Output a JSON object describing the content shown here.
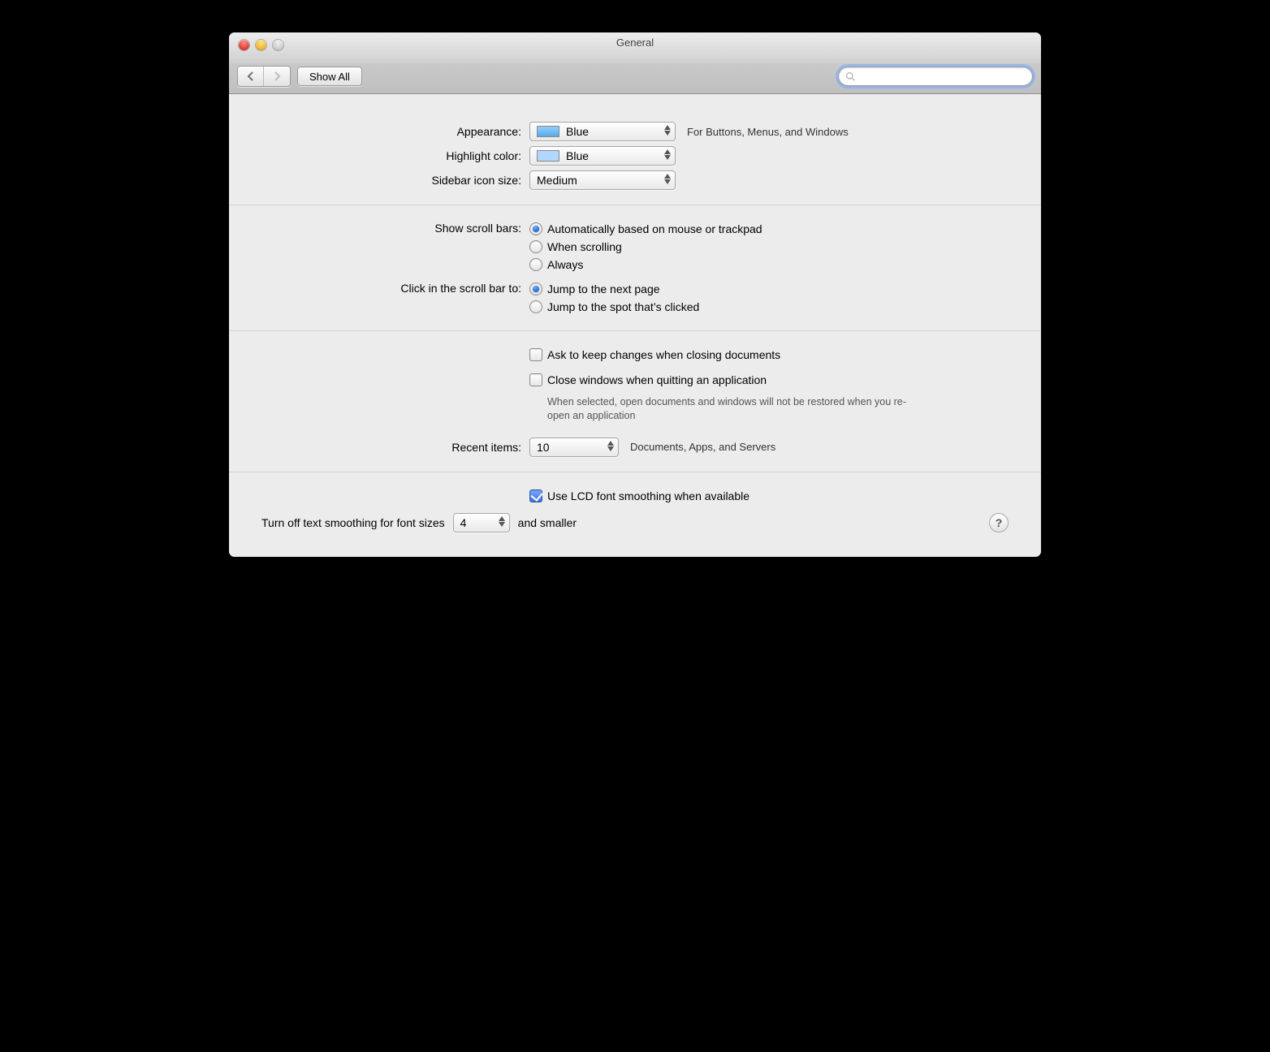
{
  "window": {
    "title": "General"
  },
  "toolbar": {
    "show_all": "Show All",
    "search_placeholder": ""
  },
  "labels": {
    "appearance": "Appearance:",
    "highlight": "Highlight color:",
    "sidebar": "Sidebar icon size:",
    "scrollbars": "Show scroll bars:",
    "click_scroll": "Click in the scroll bar to:",
    "recent": "Recent items:",
    "smoothing_prefix": "Turn off text smoothing for font sizes",
    "smoothing_suffix": "and smaller"
  },
  "values": {
    "appearance": "Blue",
    "appearance_hint": "For Buttons, Menus, and Windows",
    "highlight": "Blue",
    "sidebar": "Medium",
    "recent_count": "10",
    "recent_hint": "Documents, Apps, and Servers",
    "smoothing_size": "4"
  },
  "scroll_options": [
    {
      "label": "Automatically based on mouse or trackpad",
      "selected": true
    },
    {
      "label": "When scrolling",
      "selected": false
    },
    {
      "label": "Always",
      "selected": false
    }
  ],
  "click_options": [
    {
      "label": "Jump to the next page",
      "selected": true
    },
    {
      "label": "Jump to the spot that’s clicked",
      "selected": false
    }
  ],
  "checks": {
    "ask_keep": {
      "label": "Ask to keep changes when closing documents",
      "selected": false
    },
    "close_windows": {
      "label": "Close windows when quitting an application",
      "selected": false,
      "desc": "When selected, open documents and windows will not be restored when you re-open an application"
    },
    "lcd": {
      "label": "Use LCD font smoothing when available",
      "selected": true
    }
  },
  "help": "?"
}
